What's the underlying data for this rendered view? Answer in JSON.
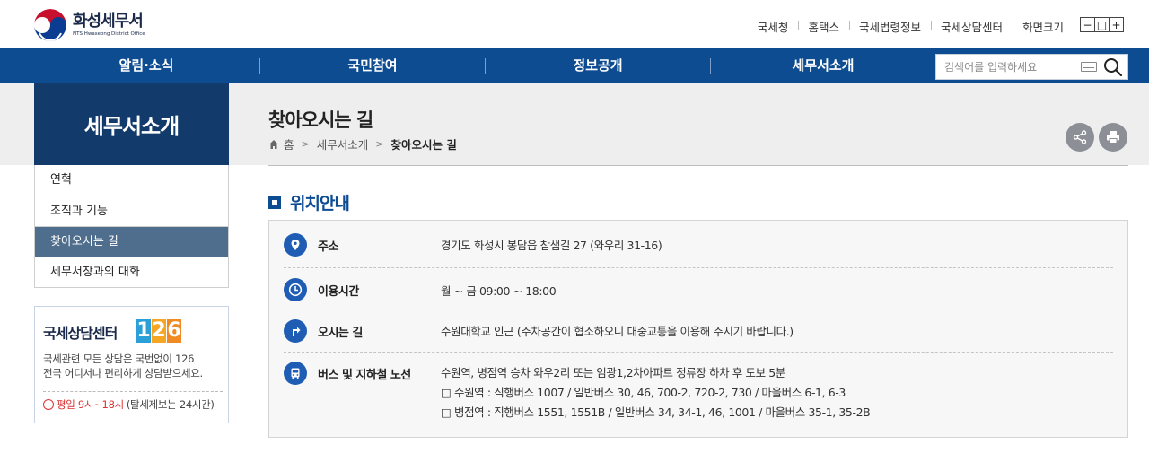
{
  "header": {
    "logo_ko": "화성세무서",
    "logo_en": "NTS Hwaseong District Office",
    "util_links": [
      "국세청",
      "홈택스",
      "국세법령정보",
      "국세상담센터",
      "화면크기"
    ],
    "zoom_buttons": [
      "−",
      "□",
      "+"
    ]
  },
  "gnb": {
    "items": [
      "알림·소식",
      "국민참여",
      "정보공개",
      "세무서소개"
    ],
    "search_placeholder": "검색어를 입력하세요"
  },
  "lnb": {
    "title": "세무서소개",
    "items": [
      "연혁",
      "조직과 기능",
      "찾아오시는 길",
      "세무서장과의 대화"
    ],
    "active_index": 2
  },
  "call_center": {
    "title": "국세상담센터",
    "digits": [
      "1",
      "2",
      "6"
    ],
    "digit_colors": [
      "#2a9fd8",
      "#f5a623",
      "#f08a24"
    ],
    "desc_line1": "국세관련 모든 상담은 국번없이 126",
    "desc_line2": "전국 어디서나 편리하게 상담받으세요.",
    "time_highlight": "평일 9시~18시",
    "time_note": "(탈세제보는 24시간)"
  },
  "page": {
    "title": "찾아오시는 길",
    "breadcrumb": [
      "홈",
      "세무서소개",
      "찾아오시는 길"
    ]
  },
  "section": {
    "title": "위치안내",
    "rows": [
      {
        "icon": "location-pin-icon",
        "label": "주소",
        "lines": [
          "경기도 화성시 봉담읍 참샘길 27 (와우리 31-16)"
        ]
      },
      {
        "icon": "clock-icon",
        "label": "이용시간",
        "lines": [
          "월 ~ 금 09:00 ~ 18:00"
        ]
      },
      {
        "icon": "directions-sign-icon",
        "label": "오시는 길",
        "lines": [
          "수원대학교 인근 (주차공간이 협소하오니 대중교통을 이용해 주시기 바랍니다.)"
        ]
      },
      {
        "icon": "bus-icon",
        "label": "버스 및 지하철 노선",
        "lines": [
          "수원역, 병점역 승차 와우2리 또는 임광1,2차아파트 정류장 하차 후 도보 5분",
          "□ 수원역 : 직행버스 1007 / 일반버스 30, 46, 700-2, 720-2, 730 / 마을버스 6-1, 6-3",
          "□ 병점역 : 직행버스 1551, 1551B / 일반버스 34, 34-1, 46, 1001 / 마을버스 35-1, 35-2B"
        ]
      }
    ]
  },
  "colors": {
    "gnb": "#0e4c92",
    "lnb_title": "#123a6a",
    "lnb_active": "#4f6d8c",
    "row_icon": "#1f5db5"
  }
}
